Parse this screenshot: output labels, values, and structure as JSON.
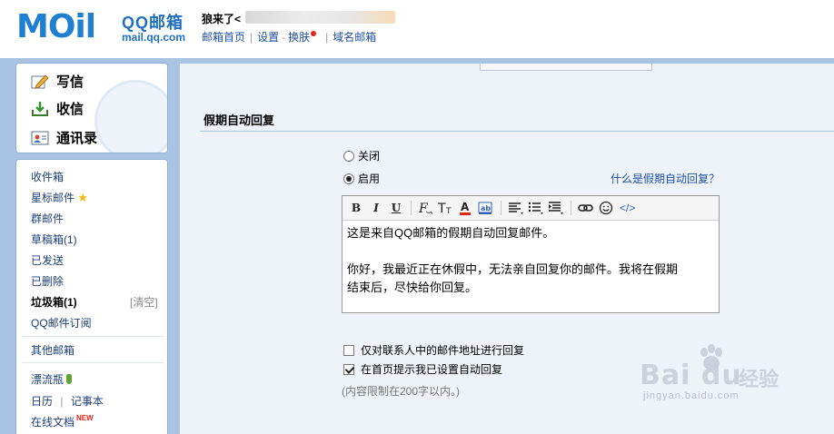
{
  "header": {
    "logo_mail": "MOil",
    "logo_brand": "QQ邮箱",
    "logo_domain": "mail.qq.com",
    "user_greeting": "狼来了<",
    "links": [
      "邮箱首页",
      "设置",
      "换肤",
      "域名邮箱"
    ],
    "link_sep": "|",
    "link_dash": "-"
  },
  "sidebar": {
    "actions": [
      {
        "label": "写信",
        "icon": "pencil-icon"
      },
      {
        "label": "收信",
        "icon": "inbox-download-icon"
      },
      {
        "label": "通讯录",
        "icon": "contact-card-icon"
      }
    ],
    "folders": {
      "inbox": "收件箱",
      "starred": "星标邮件",
      "groups": "群邮件",
      "drafts": "草稿箱(1)",
      "sent": "已发送",
      "deleted": "已删除",
      "spam": "垃圾箱(1)",
      "spam_clear": "[清空]",
      "subscriptions": "QQ邮件订阅",
      "other": "其他邮箱",
      "drift_bottle": "漂流瓶",
      "calendar": "日历",
      "notes": "记事本",
      "docs": "在线文档",
      "docs_badge": "NEW",
      "calendar_sep": "|"
    },
    "star_glyph": "★"
  },
  "main": {
    "section_title": "假期自动回复",
    "radio_off": "关闭",
    "radio_on": "启用",
    "selected": "启用",
    "help_link": "什么是假期自动回复？",
    "toolbar": {
      "bold": "B",
      "italic": "I",
      "underline": "U",
      "font_icon": "font-family-icon",
      "size_icon": "font-size-icon",
      "color_icon": "font-color-icon",
      "bg_icon": "highlight-icon",
      "align_icon": "align-icon",
      "list_icon": "list-icon",
      "indent_icon": "indent-icon",
      "link_icon": "link-icon",
      "emoji_icon": "emoji-icon",
      "html_label": "</>"
    },
    "editor_text": {
      "line1": "这是来自QQ邮箱的假期自动回复邮件。",
      "line2": "你好，我最近正在休假中，无法亲自回复你的邮件。我将在假期",
      "line3": "结束后，尽快给你回复。"
    },
    "option_contacts_only": {
      "label": "仅对联系人中的邮件地址进行回复",
      "checked": false
    },
    "option_homepage_notice": {
      "label": "在首页提示我已设置自动回复",
      "checked": true
    },
    "limit_note": "(内容限制在200字以内。)"
  },
  "watermark": {
    "brand": "Bai du",
    "cn": "经验",
    "url": "jingyan.baidu.com"
  },
  "colors": {
    "accent_blue": "#1f7fd1",
    "link_blue": "#1e50a2",
    "band": "#a9c3e3",
    "panel": "#eef3fa",
    "notice_red": "#e0261b"
  }
}
